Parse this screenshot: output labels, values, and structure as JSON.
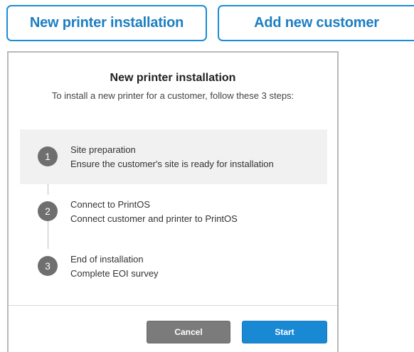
{
  "top_buttons": {
    "new_printer": "New printer installation",
    "add_customer": "Add new customer"
  },
  "dialog": {
    "title": "New printer installation",
    "subtitle": "To install a new printer for a customer, follow these 3 steps:",
    "steps": [
      {
        "number": "1",
        "title": "Site preparation",
        "description": "Ensure the customer's site is ready for installation"
      },
      {
        "number": "2",
        "title": "Connect to PrintOS",
        "description": "Connect customer and printer to PrintOS"
      },
      {
        "number": "3",
        "title": "End of installation",
        "description": "Complete EOI survey"
      }
    ],
    "cancel_label": "Cancel",
    "start_label": "Start"
  },
  "colors": {
    "accent": "#1a8ed3",
    "step_circle": "#6f6f6f",
    "cancel": "#7b7b7b",
    "start": "#1989d4"
  }
}
